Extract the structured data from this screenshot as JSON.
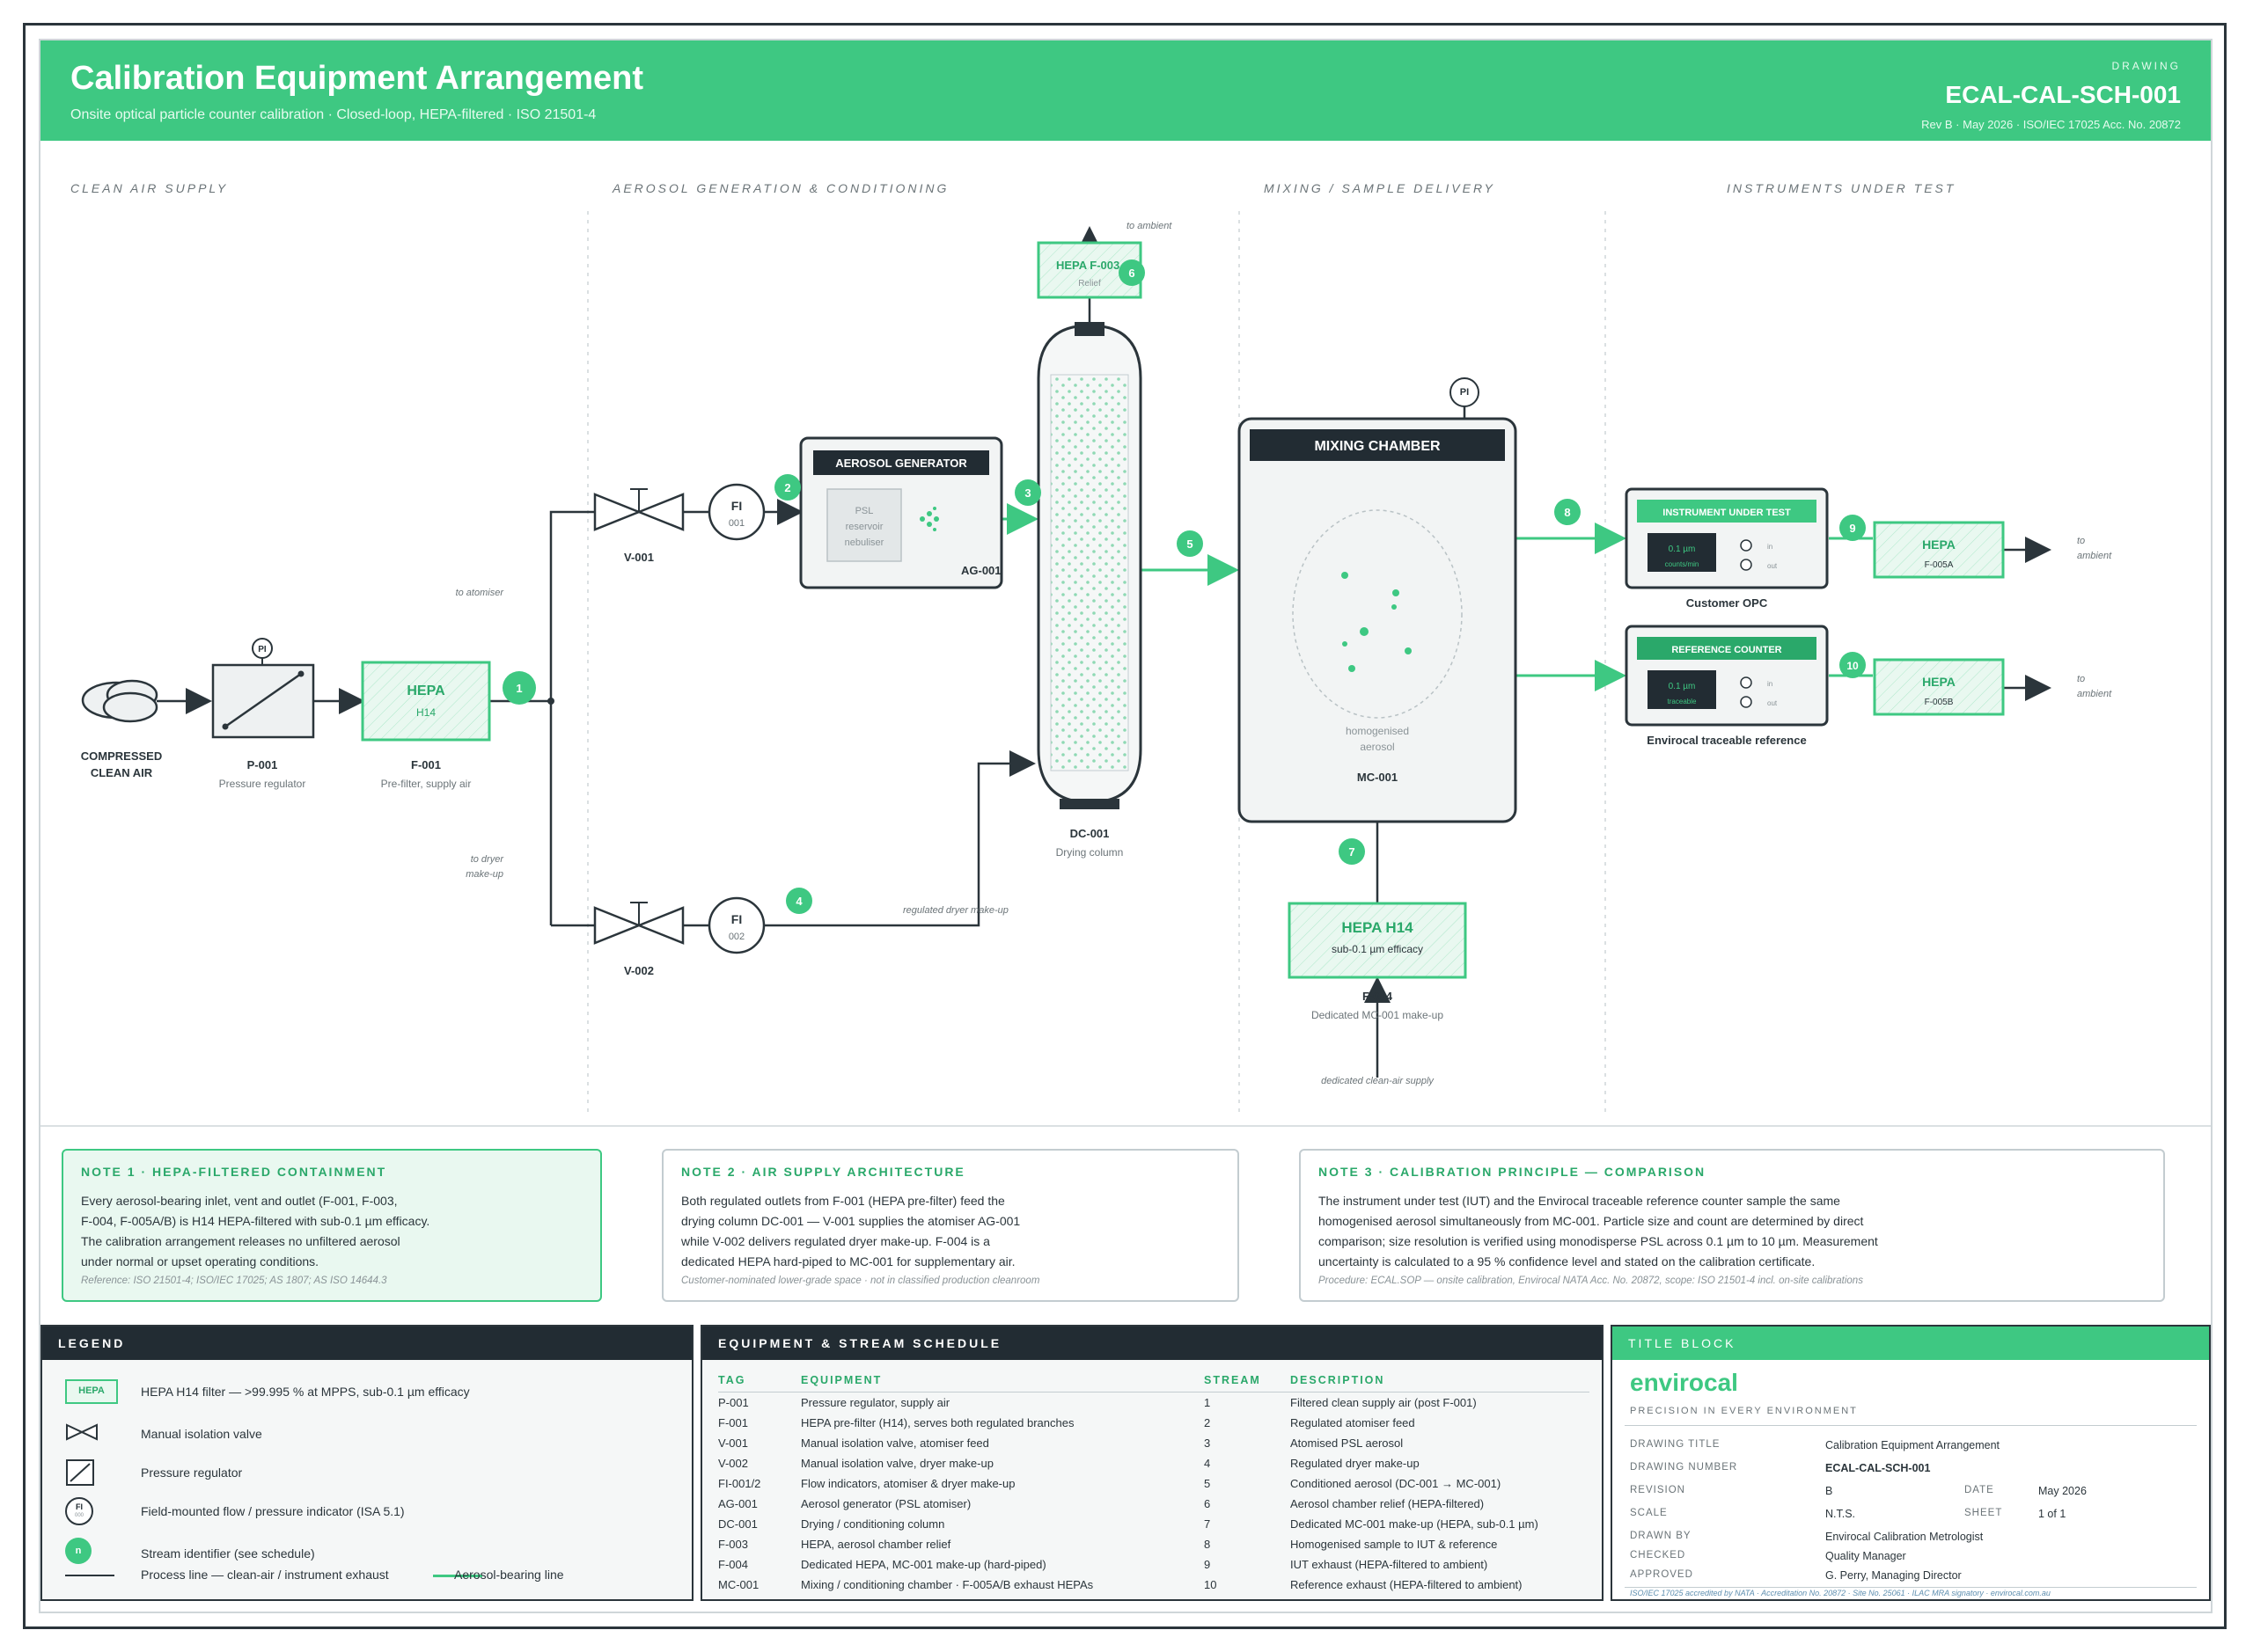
{
  "header": {
    "title": "Calibration Equipment Arrangement",
    "subtitle": "Onsite optical particle counter calibration · Closed-loop, HEPA-filtered · ISO 21501-4",
    "drawing_label": "DRAWING",
    "drawing_number": "ECAL-CAL-SCH-001",
    "revision_line": "Rev B · May 2026 · ISO/IEC 17025 Acc. No. 20872"
  },
  "zones": {
    "clean_air": "CLEAN AIR SUPPLY",
    "aerosol": "AEROSOL GENERATION & CONDITIONING",
    "mixing": "MIXING / SAMPLE DELIVERY",
    "instruments": "INSTRUMENTS UNDER TEST"
  },
  "diagram": {
    "compressed_air": [
      "COMPRESSED",
      "CLEAN AIR"
    ],
    "pi": "PI",
    "p001_tag": "P-001",
    "p001_desc": "Pressure regulator",
    "f001_title": "HEPA",
    "f001_sub": "H14",
    "f001_tag": "F-001",
    "f001_desc": "Pre-filter, supply air",
    "to_atomiser": "to atomiser",
    "to_dryer": [
      "to dryer",
      "make-up"
    ],
    "v001": "V-001",
    "v002": "V-002",
    "fi": "FI",
    "fi001": "001",
    "fi002": "002",
    "ag_title": "AEROSOL GENERATOR",
    "ag_inner": [
      "PSL",
      "reservoir",
      "nebuliser"
    ],
    "ag_tag": "AG-001",
    "regulated_dryer": "regulated dryer make-up",
    "to_ambient": "to ambient",
    "f003_title": "HEPA F-003",
    "f003_sub": "Relief",
    "dc_tag": "DC-001",
    "dc_desc": "Drying column",
    "mc_title": "MIXING CHAMBER",
    "mc_inner": [
      "homogenised",
      "aerosol"
    ],
    "mc_tag": "MC-001",
    "f004_title": "HEPA H14",
    "f004_sub": "sub-0.1 µm efficacy",
    "f004_tag": "F-004",
    "f004_desc": "Dedicated MC-001 make-up",
    "dedicated_supply": "dedicated clean-air supply",
    "iut_title": "INSTRUMENT UNDER TEST",
    "iut_display": [
      "0.1 µm",
      "counts/min"
    ],
    "iut_ports": [
      "in",
      "out"
    ],
    "iut_caption": "Customer OPC",
    "ref_title": "REFERENCE COUNTER",
    "ref_display": [
      "0.1 µm",
      "traceable"
    ],
    "ref_ports": [
      "in",
      "out"
    ],
    "ref_caption": "Envirocal traceable reference",
    "f005a_title": "HEPA",
    "f005a_sub": "F-005A",
    "f005b_title": "HEPA",
    "f005b_sub": "F-005B",
    "to_ambient_a": [
      "to",
      "ambient"
    ],
    "to_ambient_b": [
      "to",
      "ambient"
    ],
    "streams": [
      "1",
      "2",
      "3",
      "4",
      "5",
      "6",
      "7",
      "8",
      "9",
      "10"
    ]
  },
  "notes": [
    {
      "title": "NOTE 1 · HEPA-FILTERED CONTAINMENT",
      "lines": [
        "Every aerosol-bearing inlet, vent and outlet (F-001, F-003,",
        "F-004, F-005A/B) is H14 HEPA-filtered with sub-0.1 µm efficacy.",
        "The calibration arrangement releases no unfiltered aerosol",
        "under normal or upset operating conditions."
      ],
      "ref": "Reference: ISO 21501-4; ISO/IEC 17025; AS 1807; AS ISO 14644.3"
    },
    {
      "title": "NOTE 2 · AIR SUPPLY ARCHITECTURE",
      "lines": [
        "Both regulated outlets from F-001 (HEPA pre-filter) feed the",
        "drying column DC-001 — V-001 supplies the atomiser AG-001",
        "while V-002 delivers regulated dryer make-up. F-004 is a",
        "dedicated HEPA hard-piped to MC-001 for supplementary air."
      ],
      "ref": "Customer-nominated lower-grade space · not in classified production cleanroom"
    },
    {
      "title": "NOTE 3 · CALIBRATION PRINCIPLE — COMPARISON",
      "lines": [
        "The instrument under test (IUT) and the Envirocal traceable reference counter sample the same",
        "homogenised aerosol simultaneously from MC-001. Particle size and count are determined by direct",
        "comparison; size resolution is verified using monodisperse PSL across 0.1 µm to 10 µm. Measurement",
        "uncertainty is calculated to a 95 % confidence level and stated on the calibration certificate."
      ],
      "ref": "Procedure: ECAL.SOP — onsite calibration, Envirocal NATA Acc. No. 20872, scope: ISO 21501-4 incl. on-site calibrations"
    }
  ],
  "legend": {
    "title": "LEGEND",
    "hepa_chip": "HEPA",
    "hepa": "HEPA H14 filter — >99.995 % at MPPS, sub-0.1 µm efficacy",
    "valve": "Manual isolation valve",
    "regulator": "Pressure regulator",
    "fi_chip": "FI",
    "fi_chip_sub": "000",
    "indicator": "Field-mounted flow / pressure indicator (ISA 5.1)",
    "stream_chip": "n",
    "stream": "Stream identifier (see schedule)",
    "process": "Process line — clean-air / instrument exhaust",
    "aerosol": "Aerosol-bearing line"
  },
  "schedule": {
    "title": "EQUIPMENT & STREAM SCHEDULE",
    "headers": [
      "TAG",
      "EQUIPMENT",
      "STREAM",
      "DESCRIPTION"
    ],
    "rows": [
      [
        "P-001",
        "Pressure regulator, supply air",
        "1",
        "Filtered clean supply air (post F-001)"
      ],
      [
        "F-001",
        "HEPA pre-filter (H14), serves both regulated branches",
        "2",
        "Regulated atomiser feed"
      ],
      [
        "V-001",
        "Manual isolation valve, atomiser feed",
        "3",
        "Atomised PSL aerosol"
      ],
      [
        "V-002",
        "Manual isolation valve, dryer make-up",
        "4",
        "Regulated dryer make-up"
      ],
      [
        "FI-001/2",
        "Flow indicators, atomiser & dryer make-up",
        "5",
        "Conditioned aerosol (DC-001 → MC-001)"
      ],
      [
        "AG-001",
        "Aerosol generator (PSL atomiser)",
        "6",
        "Aerosol chamber relief (HEPA-filtered)"
      ],
      [
        "DC-001",
        "Drying / conditioning column",
        "7",
        "Dedicated MC-001 make-up (HEPA, sub-0.1 µm)"
      ],
      [
        "F-003",
        "HEPA, aerosol chamber relief",
        "8",
        "Homogenised sample to IUT & reference"
      ],
      [
        "F-004",
        "Dedicated HEPA, MC-001 make-up (hard-piped)",
        "9",
        "IUT exhaust (HEPA-filtered to ambient)"
      ],
      [
        "MC-001",
        "Mixing / conditioning chamber · F-005A/B exhaust HEPAs",
        "10",
        "Reference exhaust (HEPA-filtered to ambient)"
      ]
    ]
  },
  "title_block": {
    "title": "TITLE BLOCK",
    "brand": "envirocal",
    "tagline": "PRECISION IN EVERY ENVIRONMENT",
    "drawing_title_k": "DRAWING TITLE",
    "drawing_title_v": "Calibration Equipment Arrangement",
    "drawing_number_k": "DRAWING NUMBER",
    "drawing_number_v": "ECAL-CAL-SCH-001",
    "revision_k": "REVISION",
    "revision_v": "B",
    "date_k": "DATE",
    "date_v": "May 2026",
    "scale_k": "SCALE",
    "scale_v": "N.T.S.",
    "sheet_k": "SHEET",
    "sheet_v": "1 of 1",
    "drawn_k": "DRAWN BY",
    "drawn_v": "Envirocal Calibration Metrologist",
    "checked_k": "CHECKED",
    "checked_v": "Quality Manager",
    "approved_k": "APPROVED",
    "approved_v": "G. Perry, Managing Director",
    "footer": "ISO/IEC 17025 accredited by NATA · Accreditation No. 20872 · Site No. 25061 · ILAC MRA signatory · envirocal.com.au"
  },
  "colors": {
    "accent": "#3ec882",
    "accent_dark": "#2aa86a",
    "ink": "#2b353b",
    "dark_panel": "#222c33"
  }
}
